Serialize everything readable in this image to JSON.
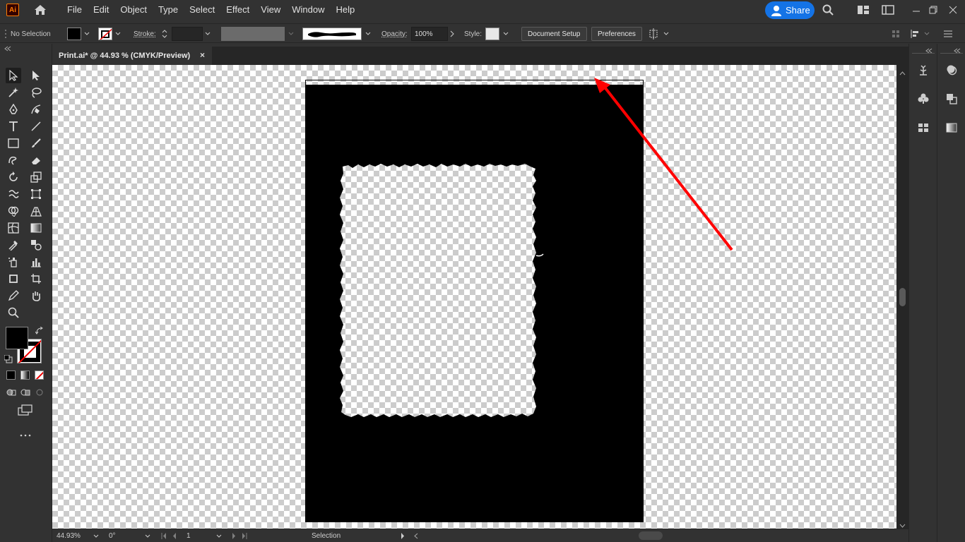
{
  "app": {
    "logo": "Ai",
    "accent": "#ff7c00"
  },
  "menu": [
    "File",
    "Edit",
    "Object",
    "Type",
    "Select",
    "Effect",
    "View",
    "Window",
    "Help"
  ],
  "share": {
    "label": "Share",
    "color": "#1473e6"
  },
  "control": {
    "selection": "No Selection",
    "stroke_label": "Stroke:",
    "opacity_label": "Opacity:",
    "opacity_value": "100%",
    "style_label": "Style:",
    "document_setup": "Document Setup",
    "preferences": "Preferences"
  },
  "tab": {
    "title": "Print.ai* @ 44.93 % (CMYK/Preview)",
    "close": "×"
  },
  "status": {
    "zoom": "44.93%",
    "rotation": "0°",
    "artboard": "1",
    "tool": "Selection"
  },
  "annotation": {
    "color": "#ff0000"
  },
  "icons": [
    "home-icon",
    "search-icon",
    "arrange-documents-icon",
    "panel-layout-icon",
    "minimize-icon",
    "restore-icon",
    "close-icon",
    "selection-tool-icon",
    "direct-selection-tool-icon",
    "magic-wand-icon",
    "lasso-icon",
    "pen-tool-icon",
    "curvature-tool-icon",
    "type-tool-icon",
    "line-tool-icon",
    "rectangle-tool-icon",
    "paintbrush-icon",
    "shaper-icon",
    "eraser-icon",
    "rotate-icon",
    "scale-icon",
    "warp-icon",
    "free-transform-icon",
    "shape-builder-icon",
    "perspective-grid-icon",
    "mesh-icon",
    "gradient-icon",
    "eyedropper-icon",
    "blend-icon",
    "symbol-sprayer-icon",
    "column-graph-icon",
    "artboard-tool-icon",
    "slice-icon",
    "hand-tool-icon",
    "zoom-tool-icon",
    "fill-swatch",
    "stroke-swatch",
    "more-tools-icon"
  ]
}
